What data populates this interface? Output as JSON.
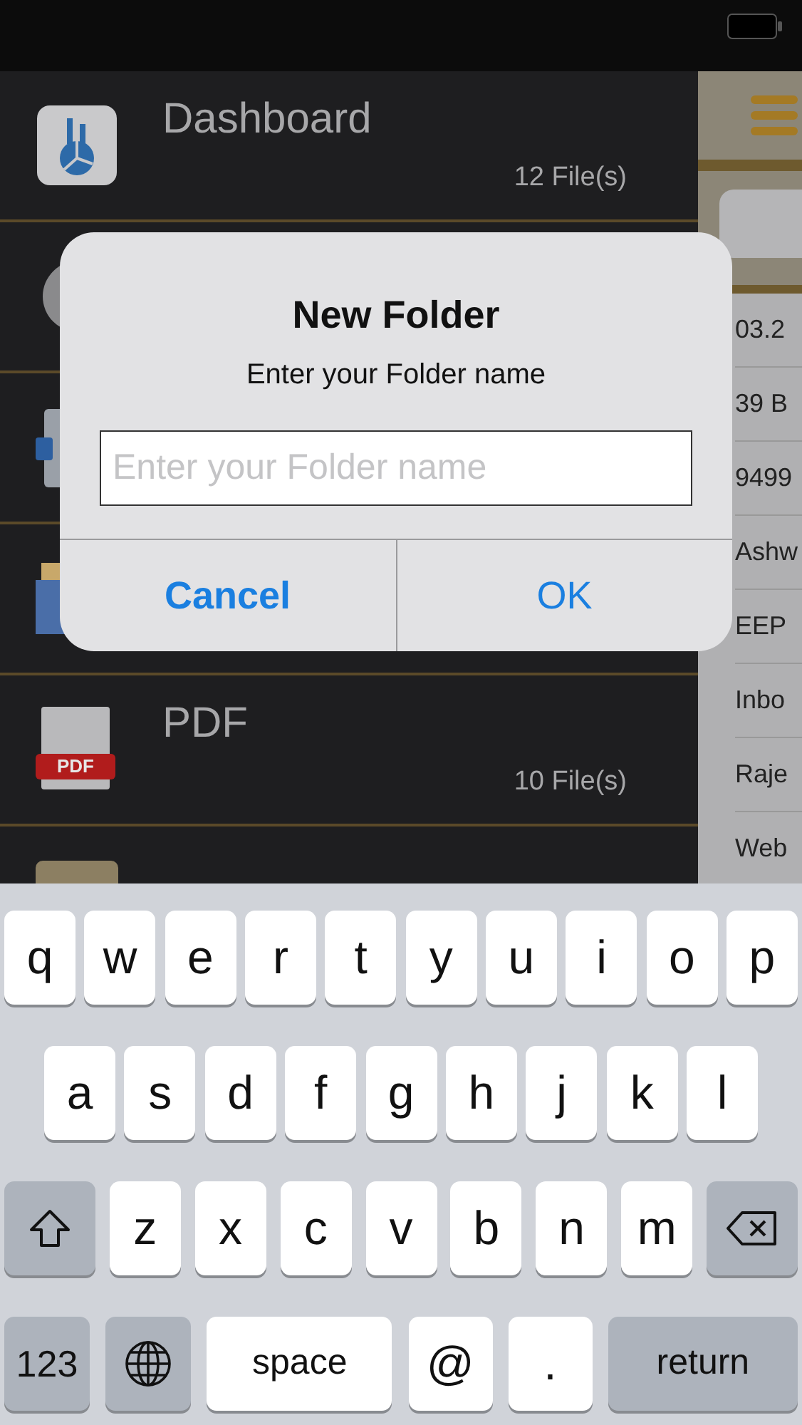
{
  "sidebar": {
    "items": [
      {
        "kind": "dashboard",
        "label": "Dashboard",
        "count": "12 File(s)"
      },
      {
        "kind": "disc"
      },
      {
        "kind": "document"
      },
      {
        "kind": "photos"
      },
      {
        "kind": "pdf",
        "icon_text": "PDF",
        "label": "PDF",
        "count": "10 File(s)"
      },
      {
        "kind": "card"
      }
    ]
  },
  "file_list": [
    "03.2",
    "39 B",
    "9499",
    "Ashw",
    "EEP",
    "Inbo",
    "Raje",
    "Web"
  ],
  "dialog": {
    "title": "New Folder",
    "message": "Enter your Folder name",
    "field": {
      "placeholder": "Enter your Folder name"
    },
    "buttons": [
      {
        "label": "Cancel",
        "preferred": true
      },
      {
        "label": "OK",
        "preferred": false
      }
    ]
  },
  "keyboard": {
    "top_row": [
      {
        "kind": "letter",
        "label": "q"
      },
      {
        "kind": "letter",
        "label": "w"
      },
      {
        "kind": "letter",
        "label": "e"
      },
      {
        "kind": "letter",
        "label": "r"
      },
      {
        "kind": "letter",
        "label": "t"
      },
      {
        "kind": "letter",
        "label": "y"
      },
      {
        "kind": "letter",
        "label": "u"
      },
      {
        "kind": "letter",
        "label": "i"
      },
      {
        "kind": "letter",
        "label": "o"
      },
      {
        "kind": "letter",
        "label": "p"
      }
    ],
    "home_row": [
      {
        "kind": "letter",
        "label": "a"
      },
      {
        "kind": "letter",
        "label": "s"
      },
      {
        "kind": "letter",
        "label": "d"
      },
      {
        "kind": "letter",
        "label": "f"
      },
      {
        "kind": "letter",
        "label": "g"
      },
      {
        "kind": "letter",
        "label": "h"
      },
      {
        "kind": "letter",
        "label": "j"
      },
      {
        "kind": "letter",
        "label": "k"
      },
      {
        "kind": "letter",
        "label": "l"
      }
    ],
    "bottom_letter_row": [
      {
        "kind": "shift"
      },
      {
        "kind": "letter",
        "label": "z"
      },
      {
        "kind": "letter",
        "label": "x"
      },
      {
        "kind": "letter",
        "label": "c"
      },
      {
        "kind": "letter",
        "label": "v"
      },
      {
        "kind": "letter",
        "label": "b"
      },
      {
        "kind": "letter",
        "label": "n"
      },
      {
        "kind": "letter",
        "label": "m"
      },
      {
        "kind": "delete"
      }
    ],
    "function_row": [
      {
        "kind": "mode",
        "label": "123"
      },
      {
        "kind": "globe"
      },
      {
        "kind": "space",
        "label": "space"
      },
      {
        "kind": "symbol",
        "label": "@"
      },
      {
        "kind": "symbol",
        "label": "."
      },
      {
        "kind": "return",
        "label": "return"
      }
    ]
  }
}
